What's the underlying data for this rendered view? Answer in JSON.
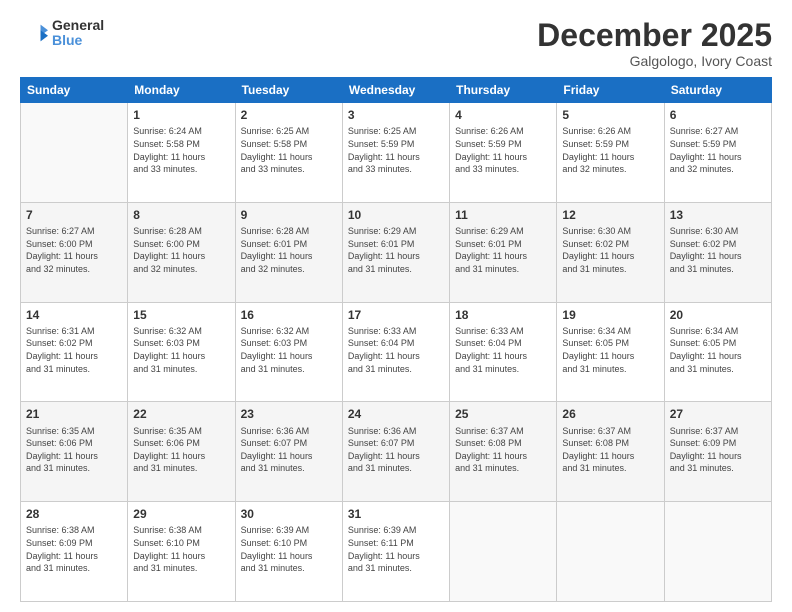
{
  "header": {
    "logo_line1": "General",
    "logo_line2": "Blue",
    "month": "December 2025",
    "location": "Galgologo, Ivory Coast"
  },
  "weekdays": [
    "Sunday",
    "Monday",
    "Tuesday",
    "Wednesday",
    "Thursday",
    "Friday",
    "Saturday"
  ],
  "weeks": [
    [
      {
        "day": "",
        "info": ""
      },
      {
        "day": "1",
        "info": "Sunrise: 6:24 AM\nSunset: 5:58 PM\nDaylight: 11 hours\nand 33 minutes."
      },
      {
        "day": "2",
        "info": "Sunrise: 6:25 AM\nSunset: 5:58 PM\nDaylight: 11 hours\nand 33 minutes."
      },
      {
        "day": "3",
        "info": "Sunrise: 6:25 AM\nSunset: 5:59 PM\nDaylight: 11 hours\nand 33 minutes."
      },
      {
        "day": "4",
        "info": "Sunrise: 6:26 AM\nSunset: 5:59 PM\nDaylight: 11 hours\nand 33 minutes."
      },
      {
        "day": "5",
        "info": "Sunrise: 6:26 AM\nSunset: 5:59 PM\nDaylight: 11 hours\nand 32 minutes."
      },
      {
        "day": "6",
        "info": "Sunrise: 6:27 AM\nSunset: 5:59 PM\nDaylight: 11 hours\nand 32 minutes."
      }
    ],
    [
      {
        "day": "7",
        "info": "Sunrise: 6:27 AM\nSunset: 6:00 PM\nDaylight: 11 hours\nand 32 minutes."
      },
      {
        "day": "8",
        "info": "Sunrise: 6:28 AM\nSunset: 6:00 PM\nDaylight: 11 hours\nand 32 minutes."
      },
      {
        "day": "9",
        "info": "Sunrise: 6:28 AM\nSunset: 6:01 PM\nDaylight: 11 hours\nand 32 minutes."
      },
      {
        "day": "10",
        "info": "Sunrise: 6:29 AM\nSunset: 6:01 PM\nDaylight: 11 hours\nand 31 minutes."
      },
      {
        "day": "11",
        "info": "Sunrise: 6:29 AM\nSunset: 6:01 PM\nDaylight: 11 hours\nand 31 minutes."
      },
      {
        "day": "12",
        "info": "Sunrise: 6:30 AM\nSunset: 6:02 PM\nDaylight: 11 hours\nand 31 minutes."
      },
      {
        "day": "13",
        "info": "Sunrise: 6:30 AM\nSunset: 6:02 PM\nDaylight: 11 hours\nand 31 minutes."
      }
    ],
    [
      {
        "day": "14",
        "info": "Sunrise: 6:31 AM\nSunset: 6:02 PM\nDaylight: 11 hours\nand 31 minutes."
      },
      {
        "day": "15",
        "info": "Sunrise: 6:32 AM\nSunset: 6:03 PM\nDaylight: 11 hours\nand 31 minutes."
      },
      {
        "day": "16",
        "info": "Sunrise: 6:32 AM\nSunset: 6:03 PM\nDaylight: 11 hours\nand 31 minutes."
      },
      {
        "day": "17",
        "info": "Sunrise: 6:33 AM\nSunset: 6:04 PM\nDaylight: 11 hours\nand 31 minutes."
      },
      {
        "day": "18",
        "info": "Sunrise: 6:33 AM\nSunset: 6:04 PM\nDaylight: 11 hours\nand 31 minutes."
      },
      {
        "day": "19",
        "info": "Sunrise: 6:34 AM\nSunset: 6:05 PM\nDaylight: 11 hours\nand 31 minutes."
      },
      {
        "day": "20",
        "info": "Sunrise: 6:34 AM\nSunset: 6:05 PM\nDaylight: 11 hours\nand 31 minutes."
      }
    ],
    [
      {
        "day": "21",
        "info": "Sunrise: 6:35 AM\nSunset: 6:06 PM\nDaylight: 11 hours\nand 31 minutes."
      },
      {
        "day": "22",
        "info": "Sunrise: 6:35 AM\nSunset: 6:06 PM\nDaylight: 11 hours\nand 31 minutes."
      },
      {
        "day": "23",
        "info": "Sunrise: 6:36 AM\nSunset: 6:07 PM\nDaylight: 11 hours\nand 31 minutes."
      },
      {
        "day": "24",
        "info": "Sunrise: 6:36 AM\nSunset: 6:07 PM\nDaylight: 11 hours\nand 31 minutes."
      },
      {
        "day": "25",
        "info": "Sunrise: 6:37 AM\nSunset: 6:08 PM\nDaylight: 11 hours\nand 31 minutes."
      },
      {
        "day": "26",
        "info": "Sunrise: 6:37 AM\nSunset: 6:08 PM\nDaylight: 11 hours\nand 31 minutes."
      },
      {
        "day": "27",
        "info": "Sunrise: 6:37 AM\nSunset: 6:09 PM\nDaylight: 11 hours\nand 31 minutes."
      }
    ],
    [
      {
        "day": "28",
        "info": "Sunrise: 6:38 AM\nSunset: 6:09 PM\nDaylight: 11 hours\nand 31 minutes."
      },
      {
        "day": "29",
        "info": "Sunrise: 6:38 AM\nSunset: 6:10 PM\nDaylight: 11 hours\nand 31 minutes."
      },
      {
        "day": "30",
        "info": "Sunrise: 6:39 AM\nSunset: 6:10 PM\nDaylight: 11 hours\nand 31 minutes."
      },
      {
        "day": "31",
        "info": "Sunrise: 6:39 AM\nSunset: 6:11 PM\nDaylight: 11 hours\nand 31 minutes."
      },
      {
        "day": "",
        "info": ""
      },
      {
        "day": "",
        "info": ""
      },
      {
        "day": "",
        "info": ""
      }
    ]
  ]
}
